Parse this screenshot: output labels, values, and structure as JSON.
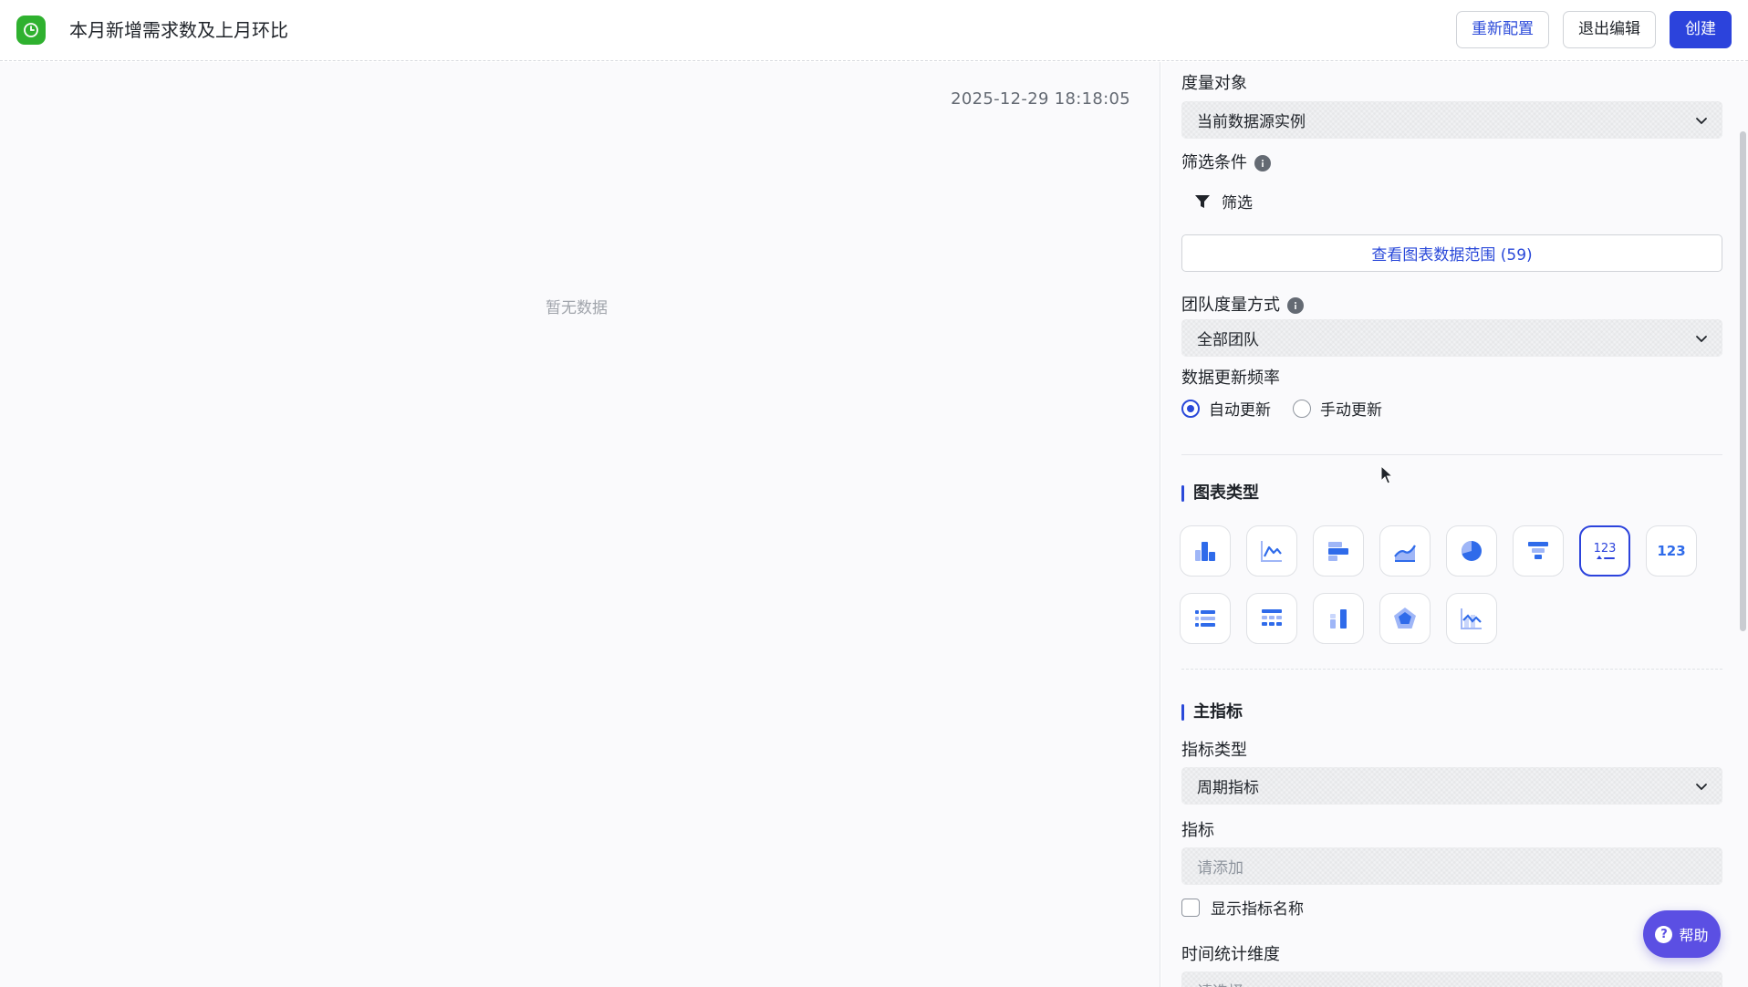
{
  "header": {
    "title": "本月新增需求数及上月环比",
    "buttons": {
      "reconfigure": "重新配置",
      "exit_edit": "退出编辑",
      "create": "创建"
    }
  },
  "canvas": {
    "timestamp": "2025-12-29 18:18:05",
    "empty_text": "暂无数据"
  },
  "config": {
    "measure_object": {
      "label": "度量对象",
      "value": "当前数据源实例"
    },
    "filter": {
      "label": "筛选条件",
      "action": "筛选"
    },
    "data_range_button": "查看图表数据范围 (59)",
    "team_measure": {
      "label": "团队度量方式",
      "value": "全部团队"
    },
    "update_frequency": {
      "label": "数据更新频率",
      "options": [
        "自动更新",
        "手动更新"
      ],
      "selected": "自动更新"
    },
    "chart_type": {
      "title": "图表类型",
      "types": [
        "bar-chart",
        "line-chart",
        "horizontal-bar-chart",
        "area-chart",
        "pie-chart",
        "funnel-chart",
        "metric-comparison-card",
        "metric-card",
        "list",
        "detail-table",
        "stacked-column-chart",
        "radar-chart",
        "combo-chart"
      ],
      "selected": "metric-comparison-card"
    },
    "main_metric": {
      "title": "主指标",
      "metric_type": {
        "label": "指标类型",
        "value": "周期指标"
      },
      "metric": {
        "label": "指标",
        "placeholder": "请添加"
      },
      "show_name": "显示指标名称",
      "time_dimension": {
        "label": "时间统计维度",
        "placeholder": "请选择"
      }
    }
  },
  "help": {
    "label": "帮助"
  },
  "colors": {
    "primary": "#2C43DC",
    "accent_blue": "#2A49D9",
    "help_purple": "#5B4FE3",
    "logo_green": "#2FB12F"
  }
}
